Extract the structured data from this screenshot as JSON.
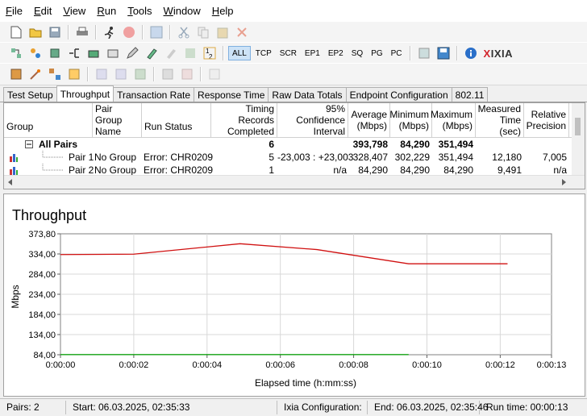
{
  "menu": [
    {
      "first": "F",
      "rest": "ile"
    },
    {
      "first": "E",
      "rest": "dit"
    },
    {
      "first": "V",
      "rest": "iew"
    },
    {
      "first": "R",
      "rest": "un"
    },
    {
      "first": "T",
      "rest": "ools"
    },
    {
      "first": "W",
      "rest": "indow"
    },
    {
      "first": "H",
      "rest": "elp"
    }
  ],
  "toolbar2": {
    "filters": [
      "ALL",
      "TCP",
      "SCR",
      "EP1",
      "EP2",
      "SQ",
      "PG",
      "PC"
    ],
    "active_filter": "ALL",
    "logo": {
      "x": "X",
      "rest": "IXIA"
    }
  },
  "tabs": [
    "Test Setup",
    "Throughput",
    "Transaction Rate",
    "Response Time",
    "Raw Data Totals",
    "Endpoint Configuration",
    "802.11"
  ],
  "active_tab": "Throughput",
  "grid": {
    "headers": {
      "group": "Group",
      "pair_group_name": "Pair Group Name",
      "run_status": "Run Status",
      "timing_records": "Timing Records Completed",
      "confidence": "95% Confidence Interval",
      "average": "Average (Mbps)",
      "minimum": "Minimum (Mbps)",
      "maximum": "Maximum (Mbps)",
      "measured": "Measured Time (sec)",
      "relative": "Relative Precision"
    },
    "summary": {
      "label": "All Pairs",
      "records": "6",
      "average": "393,798",
      "minimum": "84,290",
      "maximum": "351,494"
    },
    "rows": [
      {
        "pair": "Pair 1",
        "group_name": "No Group",
        "status": "Error:  CHR0209",
        "records": "5",
        "confidence": "-23,003 : +23,003",
        "average": "328,407",
        "minimum": "302,229",
        "maximum": "351,494",
        "measured": "12,180",
        "relative": "7,005"
      },
      {
        "pair": "Pair 2",
        "group_name": "No Group",
        "status": "Error:  CHR0209",
        "records": "1",
        "confidence": "n/a",
        "average": "84,290",
        "minimum": "84,290",
        "maximum": "84,290",
        "measured": "9,491",
        "relative": "n/a"
      }
    ]
  },
  "chart_data": {
    "type": "line",
    "title": "Throughput",
    "xlabel": "Elapsed time (h:mm:ss)",
    "ylabel": "Mbps",
    "x_ticks": [
      "0:00:00",
      "0:00:02",
      "0:00:04",
      "0:00:06",
      "0:00:08",
      "0:00:10",
      "0:00:12",
      "0:00:13"
    ],
    "y_ticks": [
      "373,80",
      "334,00",
      "284,00",
      "234,00",
      "184,00",
      "134,00",
      "84,00"
    ],
    "ylim": [
      84.0,
      373.8
    ],
    "xlim": [
      0,
      13.4
    ],
    "grid": true,
    "series": [
      {
        "color": "#d01010",
        "x": [
          0,
          2,
          4.9,
          7,
          9.5,
          12.2
        ],
        "y": [
          324,
          325,
          350,
          336,
          302,
          302
        ]
      },
      {
        "color": "#10a010",
        "x": [
          0,
          9.5
        ],
        "y": [
          84.4,
          84.4
        ]
      }
    ]
  },
  "status": {
    "pairs": "Pairs: 2",
    "start": "Start: 06.03.2025, 02:35:33",
    "ixia_config": "Ixia Configuration:",
    "end": "End: 06.03.2025, 02:35:46",
    "runtime": "Run time: 00:00:13"
  }
}
